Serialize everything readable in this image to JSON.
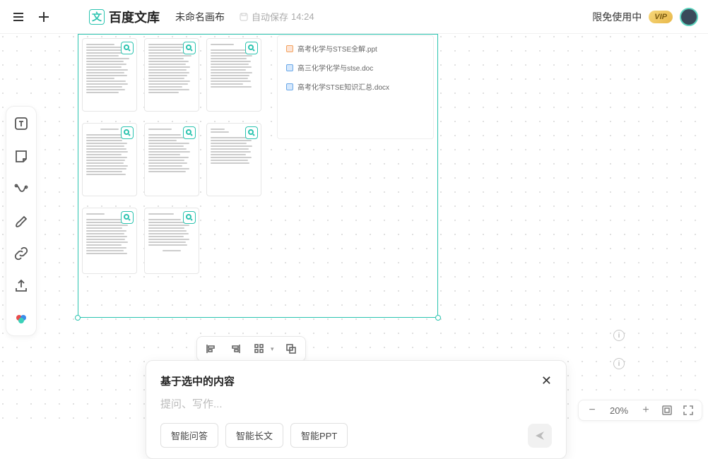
{
  "header": {
    "logo_char": "文",
    "logo_text": "百度文库",
    "canvas_name": "未命名画布",
    "autosave_label": "自动保存",
    "autosave_time": "14:24",
    "trial_label": "限免使用中",
    "vip_label": "VIP"
  },
  "files": [
    {
      "icon": "p",
      "name": "高考化学与STSE全解.ppt"
    },
    {
      "icon": "w",
      "name": "高三化学化学与stse.doc"
    },
    {
      "icon": "w",
      "name": "高考化学STSE知识汇总.docx"
    }
  ],
  "ai_panel": {
    "title": "基于选中的内容",
    "placeholder": "提问、写作...",
    "chips": [
      "智能问答",
      "智能长文",
      "智能PPT"
    ]
  },
  "zoom": {
    "value": "20%"
  }
}
